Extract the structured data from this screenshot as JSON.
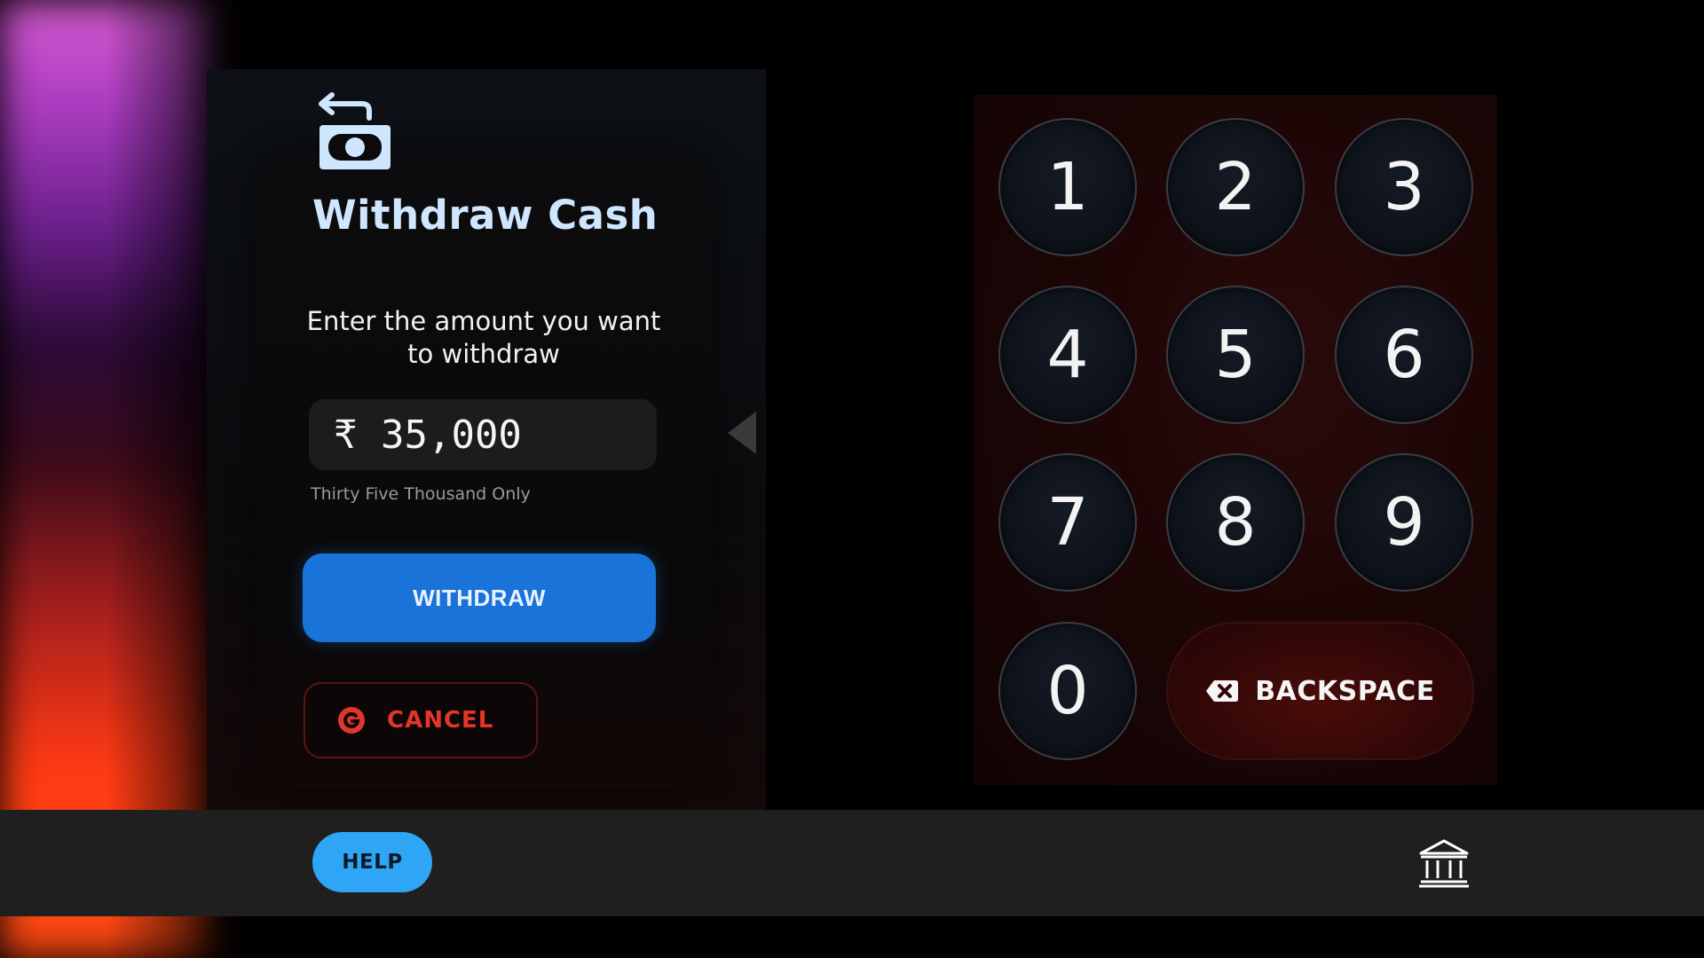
{
  "screen": {
    "title": "Withdraw Cash",
    "prompt": "Enter the amount you want to withdraw",
    "amount": "₹ 35,000",
    "amount_in_words": "Thirty Five Thousand Only",
    "withdraw_label": "WITHDRAW",
    "cancel_label": "CANCEL"
  },
  "keypad": {
    "keys": [
      "1",
      "2",
      "3",
      "4",
      "5",
      "6",
      "7",
      "8",
      "9",
      "0"
    ],
    "backspace_label": "BACKSPACE"
  },
  "footer": {
    "help_label": "HELP"
  },
  "icons": {
    "withdraw": "cash-withdraw-icon",
    "cancel": "cancel-icon",
    "backspace": "backspace-icon",
    "keypad_arrow": "arrow-left-icon",
    "bank": "bank-icon"
  },
  "colors": {
    "accent_blue": "#1a73d9",
    "help_blue": "#2fa5f5",
    "cancel_red": "#e2362a",
    "title_color": "#cfe6ff",
    "backspace_bg": "#4a0d08"
  }
}
